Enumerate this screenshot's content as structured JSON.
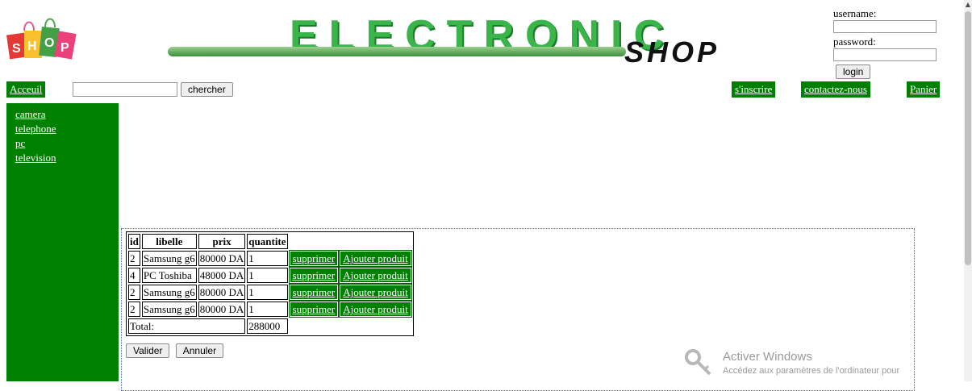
{
  "logo": {
    "text": "SHOP"
  },
  "banner": {
    "title": "ELECTRONIC",
    "subtitle": "SHOP"
  },
  "login": {
    "username_label": "username:",
    "password_label": "password:",
    "button": "login"
  },
  "nav": {
    "home": "Acceuil",
    "search_button": "chercher",
    "signup": "s'inscrire",
    "contact": "contactez-nous",
    "cart": "Panier"
  },
  "sidebar": {
    "items": [
      "camera",
      "telephone",
      "pc",
      "television"
    ]
  },
  "cart": {
    "headers": [
      "id",
      "libelle",
      "prix",
      "quantite"
    ],
    "rows": [
      {
        "id": "2",
        "libelle": "Samsung g6",
        "prix": "80000 DA",
        "quantite": "1"
      },
      {
        "id": "4",
        "libelle": "PC Toshiba",
        "prix": "48000 DA",
        "quantite": "1"
      },
      {
        "id": "2",
        "libelle": "Samsung g6",
        "prix": "80000 DA",
        "quantite": "1"
      },
      {
        "id": "2",
        "libelle": "Samsung g6",
        "prix": "80000 DA",
        "quantite": "1"
      }
    ],
    "delete_label": "supprimer",
    "add_label": "Ajouter produit",
    "total_label": "Total:",
    "total_value": "288000",
    "validate_button": "Valider",
    "cancel_button": "Annuler"
  },
  "watermark": {
    "title": "Activer Windows",
    "subtitle": "Accédez aux paramètres de l'ordinateur pour"
  },
  "colors": {
    "accent": "#008000",
    "banner": "#3ab54a"
  }
}
